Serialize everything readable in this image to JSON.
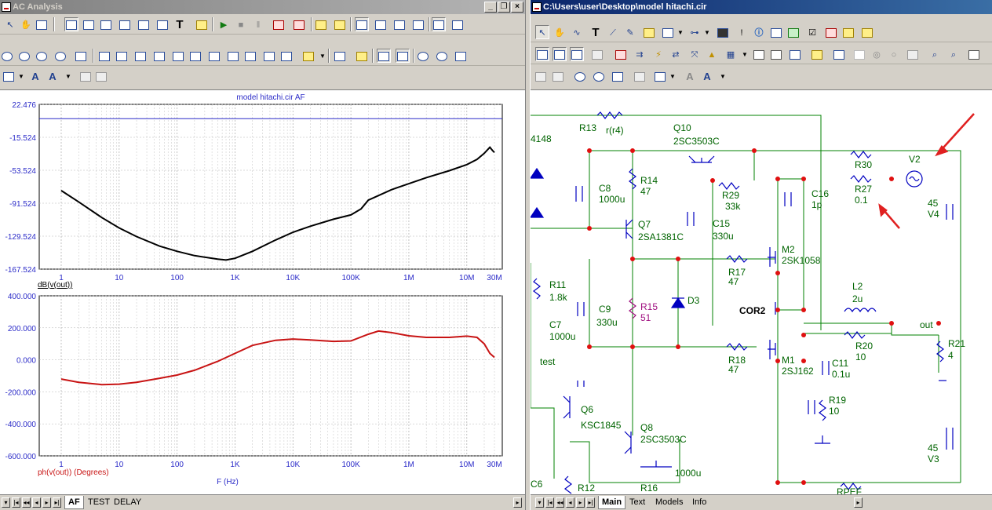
{
  "left_window": {
    "title": "AC Analysis",
    "chart_data": [
      {
        "type": "line",
        "title": "model hitachi.cir AF",
        "xlabel": "",
        "ylabel": "dB(v(out))",
        "x_scale": "log",
        "x_tick_labels": [
          "1",
          "10",
          "100",
          "1K",
          "10K",
          "100K",
          "1M",
          "10M",
          "30M"
        ],
        "x_ticks": [
          1,
          10,
          100,
          1000,
          10000,
          100000,
          1000000,
          10000000,
          30000000
        ],
        "y_tick_labels": [
          "22.476",
          "-15.524",
          "-53.524",
          "-91.524",
          "-129.524",
          "-167.524"
        ],
        "ylim": [
          -167.524,
          22.476
        ],
        "grid": true,
        "reference_line": 6,
        "colors": {
          "series": "#000000",
          "reference": "#2b2bc8"
        },
        "series": [
          {
            "x": [
              1,
              2,
              5,
              10,
              20,
              50,
              100,
              200,
              500,
              700,
              1000,
              2000,
              5000,
              10000,
              20000,
              50000,
              100000,
              150000,
              200000,
              500000,
              1000000,
              2000000,
              5000000,
              10000000,
              15000000,
              20000000,
              25000000,
              28000000,
              30000000
            ],
            "values": [
              -77,
              -90,
              -108,
              -120,
              -130,
              -141,
              -147,
              -152,
              -156,
              -157,
              -155,
              -147,
              -134,
              -125,
              -118,
              -110,
              -105,
              -98,
              -88,
              -76,
              -69,
              -62,
              -54,
              -47,
              -41,
              -34,
              -27,
              -31,
              -33
            ]
          }
        ]
      },
      {
        "type": "line",
        "title": "",
        "xlabel": "F (Hz)",
        "ylabel": "ph(v(out)) (Degrees)",
        "x_scale": "log",
        "x_tick_labels": [
          "1",
          "10",
          "100",
          "1K",
          "10K",
          "100K",
          "1M",
          "10M",
          "30M"
        ],
        "x_ticks": [
          1,
          10,
          100,
          1000,
          10000,
          100000,
          1000000,
          10000000,
          30000000
        ],
        "y_tick_labels": [
          "400.000",
          "200.000",
          "0.000",
          "-200.000",
          "-400.000",
          "-600.000"
        ],
        "ylim": [
          -600,
          400
        ],
        "grid": true,
        "colors": {
          "series": "#c81414"
        },
        "series": [
          {
            "x": [
              1,
              2,
              5,
              10,
              20,
              50,
              100,
              200,
              500,
              1000,
              2000,
              5000,
              10000,
              20000,
              50000,
              100000,
              200000,
              300000,
              500000,
              1000000,
              2000000,
              5000000,
              10000000,
              15000000,
              20000000,
              25000000,
              30000000
            ],
            "values": [
              -120,
              -140,
              -155,
              -152,
              -140,
              -115,
              -95,
              -65,
              -10,
              40,
              90,
              122,
              130,
              124,
              115,
              118,
              160,
              180,
              170,
              150,
              140,
              140,
              148,
              140,
              100,
              40,
              15
            ]
          }
        ]
      }
    ],
    "tabs": [
      "AF",
      "TEST",
      "DELAY"
    ],
    "active_tab": "AF"
  },
  "right_window": {
    "title": "C:\\Users\\user\\Desktop\\model hitachi.cir",
    "tabs": [
      "Main",
      "Text",
      "Models",
      "Info"
    ],
    "active_tab": "Main",
    "schematic": {
      "labels": {
        "r13": "R13",
        "r13_val": "r(r4)",
        "d4148": "4148",
        "q10": "Q10",
        "q10_val": "2SC3503C",
        "c8": "C8",
        "c8_val": "1000u",
        "r14": "R14",
        "r14_val": "47",
        "r29": "R29",
        "r29_val": "33k",
        "c15": "C15",
        "c15_val": "330u",
        "q7": "Q7",
        "q7_val": "2SA1381C",
        "r30": "R30",
        "r27": "R27",
        "r27_val": "0.1",
        "v2": "V2",
        "c16": "C16",
        "c16_val": "1p",
        "v4_val": "45",
        "v4": "V4",
        "m2": "M2",
        "m2_val": "2SK1058",
        "r17": "R17",
        "r17_val": "47",
        "r11": "R11",
        "r11_val": "1.8k",
        "c9": "C9",
        "c9_val": "330u",
        "r15": "R15",
        "r15_val": "51",
        "d3": "D3",
        "cor2": "COR2",
        "l2": "L2",
        "l2_val": "2u",
        "out": "out",
        "r21": "R21",
        "r21_val": "4",
        "c7": "C7",
        "c7_val": "1000u",
        "test": "test",
        "r20": "R20",
        "r20_val": "10",
        "r18": "R18",
        "r18_val": "47",
        "m1": "M1",
        "m1_val": "2SJ162",
        "c11": "C11",
        "c11_val": "0.1u",
        "r19": "R19",
        "r19_val": "10",
        "q6": "Q6",
        "q6_val": "KSC1845",
        "q8": "Q8",
        "q8_val": "2SC3503C",
        "v3_val": "45",
        "v3": "V3",
        "c6": "C6",
        "r12": "R12",
        "r16": "R16",
        "c_bot_val": "1000u",
        "rpef": "RPEF"
      },
      "colors": {
        "wire": "#008000",
        "component": "#0000c0",
        "text": "#006400",
        "node": "#e01010",
        "arrow": "#e02020",
        "magenta": "#a01080"
      }
    }
  },
  "colors": {
    "titlebar_active": "#0a246a",
    "titlebar_inactive": "#808080",
    "window_bg": "#d4d0c8",
    "plot_title": "#2b2bc8",
    "grid": "#b4b4b4"
  }
}
